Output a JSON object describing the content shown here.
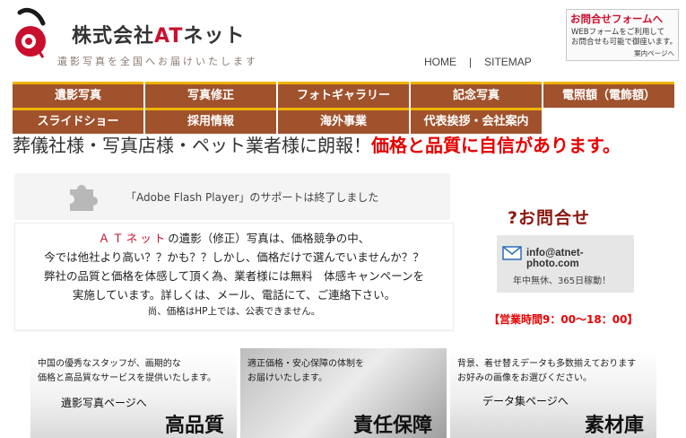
{
  "header": {
    "company_prefix": "株式会社",
    "company_at": "AT",
    "company_suffix": "ネット",
    "tagline": "遺影写真を全国へお届けいたします",
    "nav_home": "HOME",
    "nav_sep": "|",
    "nav_sitemap": "SITEMAP"
  },
  "contact_box": {
    "title": "お問合せフォームへ",
    "line1": "WEBフォームをご利用して",
    "line2": "お問合せも可能で御座います。",
    "link": "案内ページへ"
  },
  "nav": {
    "row1": [
      "遺影写真",
      "写真修正",
      "フォトギャラリー",
      "記念写真",
      "電照額（電飾額）"
    ],
    "row2": [
      "スライドショー",
      "採用情報",
      "海外事業",
      "代表挨拶・会社案内"
    ]
  },
  "headline": {
    "plain": "葬儀社様・写真店様・ペット業者様に朗報！",
    "emph": "価格と品質に自信があります。"
  },
  "flash": {
    "message": "「Adobe Flash Player」のサポートは終了しました"
  },
  "intro": {
    "line1_at": "ＡＴネット",
    "line1_rest": "の遺影（修正）写真は、価格競争の中、",
    "line2": "今では他社より高い？？かも？？しかし、価格だけで選んでいませんか？？",
    "line3": "弊社の品質と価格を体感して頂く為、業者様には無料　体感キャンペーンを",
    "line4": "実施しています。詳しくは、メール、電話にて、ご連絡下さい。",
    "line5": "尚、価格はHP上では、公表できません。"
  },
  "side_contact": {
    "title": "?お問合せ",
    "email": "info@atnet-photo.com",
    "note": "年中無休、365日稼動！",
    "hours": "【営業時間9：00〜18：00】"
  },
  "banners": [
    {
      "desc1": "中国の優秀なスタッフが、画期的な",
      "desc2": "価格と高品質なサービスを提供いたします。",
      "link": "遺影写真ページへ",
      "big": "高品質"
    },
    {
      "desc1": "適正価格・安心保障の体制を",
      "desc2": "お届けいたします。",
      "link": "",
      "big": "責任保障"
    },
    {
      "desc1": "背景、着せ替えデータも多数揃えております",
      "desc2": "お好みの画像をお選びください。",
      "link": "データ集ページへ",
      "big": "素材庫"
    }
  ],
  "colors": {
    "nav_bg": "#a0522d",
    "nav_border": "#f0b400",
    "accent_red": "#e60000"
  }
}
